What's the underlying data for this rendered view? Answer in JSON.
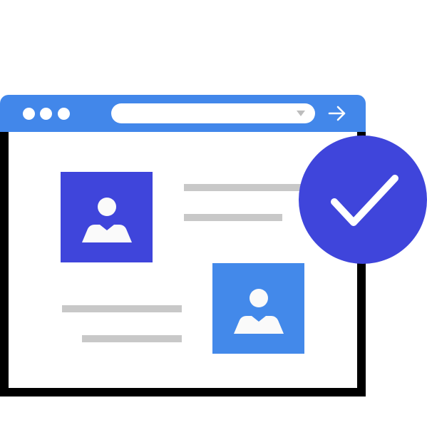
{
  "colors": {
    "accent": "#4287ea",
    "card1": "#3f45db",
    "card2": "#4389ea",
    "badge": "#3f45db",
    "placeholder_line": "#c8c8c8"
  },
  "browser": {
    "window_controls": [
      "dot",
      "dot",
      "dot"
    ],
    "address_bar": {
      "value": "",
      "dropdown_icon": "caret-down-icon"
    },
    "go_icon": "arrow-right-icon"
  },
  "profiles": [
    {
      "icon": "user-icon"
    },
    {
      "icon": "user-icon"
    }
  ],
  "badge": {
    "icon": "checkmark-icon"
  }
}
